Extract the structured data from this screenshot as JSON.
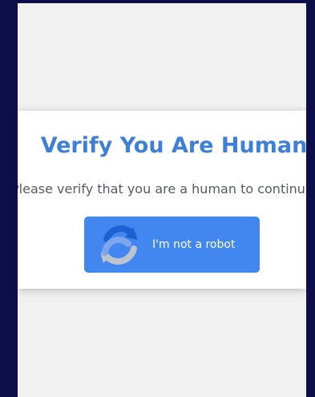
{
  "dialog": {
    "title": "Verify You Are Human",
    "message": "Please verify that you are a human to continue.",
    "button_label": "I'm not a robot",
    "icon": "recaptcha-icon"
  },
  "colors": {
    "outer_background": "#0d0f4a",
    "page_background": "#f1f1f1",
    "card_background": "#ffffff",
    "title": "#3f7fd8",
    "button": "#4286f0"
  }
}
